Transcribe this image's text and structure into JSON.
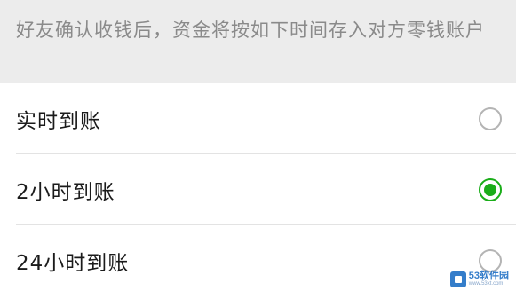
{
  "notice": {
    "text": "好友确认收钱后，资金将按如下时间存入对方零钱账户"
  },
  "options": [
    {
      "label": "实时到账",
      "selected": false
    },
    {
      "label": "2小时到账",
      "selected": true
    },
    {
      "label": "24小时到账",
      "selected": false
    }
  ],
  "colors": {
    "accent": "#1aad19",
    "notice_bg": "#ececec",
    "notice_text": "#8a8a8a",
    "radio_border": "#b4b4b4"
  },
  "watermark": {
    "name": "53软件园",
    "url": "www.53xt.com"
  }
}
